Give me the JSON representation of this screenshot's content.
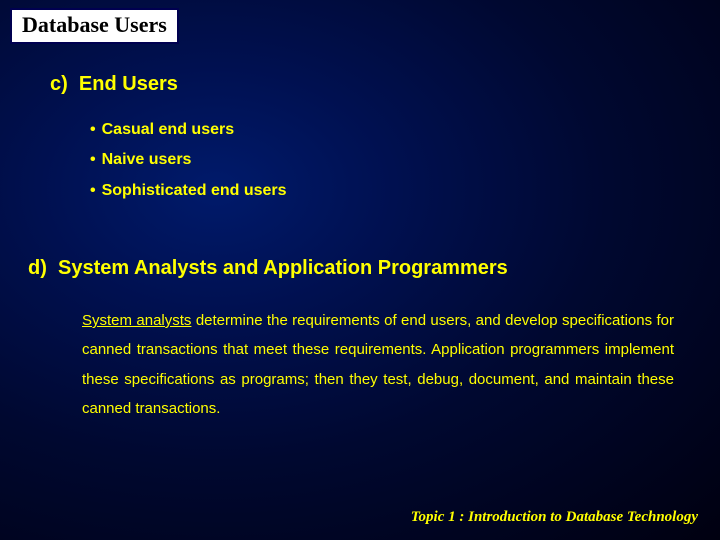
{
  "title": "Database Users",
  "sections": {
    "c": {
      "label": "c)",
      "heading": "End Users",
      "bullets": [
        "Casual end users",
        "Naive users",
        "Sophisticated end users"
      ]
    },
    "d": {
      "label": "d)",
      "heading": "System Analysts and Application Programmers",
      "underlined_lead": "System analysts",
      "paragraph_rest": " determine the requirements of end users, and develop specifications for canned transactions that meet these requirements. Application programmers implement these specifications as programs; then they test, debug, document, and maintain these canned transactions."
    }
  },
  "footer": "Topic 1 : Introduction to Database Technology"
}
